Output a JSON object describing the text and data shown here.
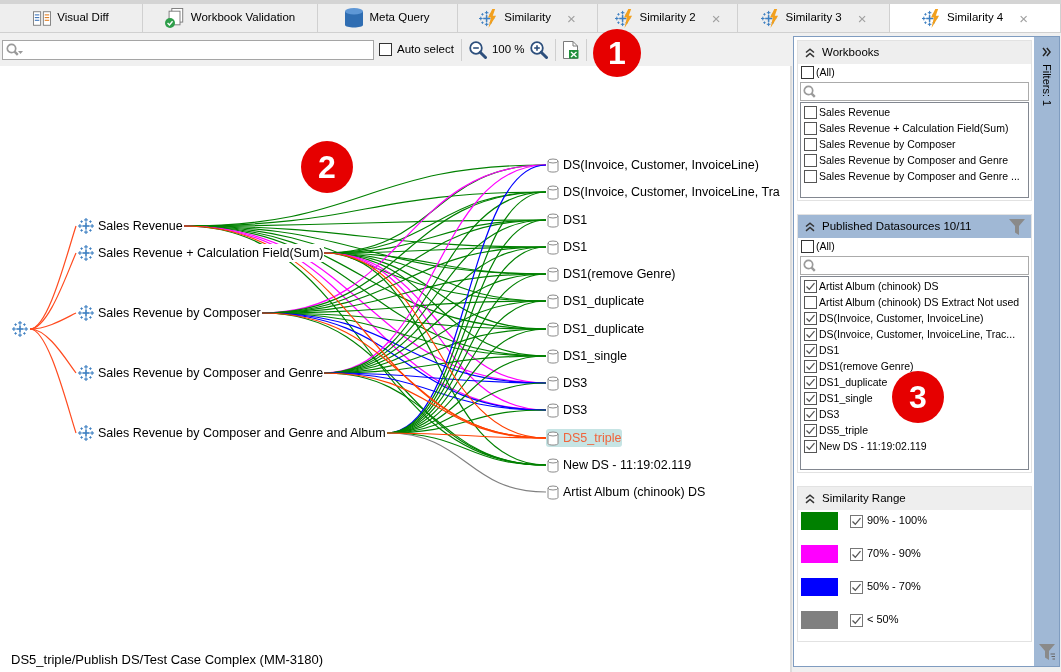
{
  "tabs": [
    {
      "label": "Visual Diff",
      "kind": "diff",
      "selected": false
    },
    {
      "label": "Workbook Validation",
      "kind": "validation",
      "selected": false
    },
    {
      "label": "Meta Query",
      "kind": "query",
      "selected": false
    },
    {
      "label": "Similarity",
      "kind": "similarity",
      "selected": false,
      "close": "×"
    },
    {
      "label": "Similarity 2",
      "kind": "similarity",
      "selected": false,
      "close": "×"
    },
    {
      "label": "Similarity 3",
      "kind": "similarity",
      "selected": false,
      "close": "×"
    },
    {
      "label": "Similarity 4",
      "kind": "similarity",
      "selected": true,
      "close": "×"
    }
  ],
  "toolbar": {
    "auto_select": {
      "label": "Auto select",
      "checked": false
    },
    "zoom": "100 %"
  },
  "graph": {
    "workbooks": [
      {
        "label": "Sales Revenue",
        "edges": [
          {
            "kind": "high"
          },
          {
            "kind": "high"
          },
          {
            "kind": "high"
          },
          {
            "kind": "high"
          },
          {
            "kind": "high"
          },
          {
            "kind": "high"
          },
          {
            "kind": "high"
          },
          {
            "kind": "high"
          },
          {
            "kind": "medium"
          },
          {
            "kind": "medium"
          },
          {
            "kind": "highlighted"
          },
          {
            "kind": "high"
          }
        ]
      },
      {
        "label": "Sales Revenue + Calculation Field(Sum)",
        "edges": [
          {
            "kind": "high"
          },
          {
            "kind": "high"
          },
          {
            "kind": "high"
          },
          {
            "kind": "high"
          },
          {
            "kind": "high"
          },
          {
            "kind": "high"
          },
          {
            "kind": "high"
          },
          {
            "kind": "high"
          },
          {
            "kind": "medium"
          },
          {
            "kind": "medium"
          },
          {
            "kind": "highlighted"
          },
          {
            "kind": "high"
          }
        ]
      },
      {
        "label": "Sales Revenue by Composer",
        "edges": [
          {
            "kind": "medium"
          },
          {
            "kind": "high"
          },
          {
            "kind": "high"
          },
          {
            "kind": "high"
          },
          {
            "kind": "high"
          },
          {
            "kind": "high"
          },
          {
            "kind": "high"
          },
          {
            "kind": "high"
          },
          {
            "kind": "low"
          },
          {
            "kind": "low"
          },
          {
            "kind": "highlighted"
          },
          {
            "kind": "high"
          }
        ]
      },
      {
        "label": "Sales Revenue by Composer and Genre",
        "edges": [
          {
            "kind": "medium"
          },
          {
            "kind": "high"
          },
          {
            "kind": "high"
          },
          {
            "kind": "high"
          },
          {
            "kind": "high"
          },
          {
            "kind": "high"
          },
          {
            "kind": "high"
          },
          {
            "kind": "high"
          },
          {
            "kind": "low"
          },
          {
            "kind": "low"
          },
          {
            "kind": "highlighted"
          },
          {
            "kind": "high"
          }
        ]
      },
      {
        "label": "Sales Revenue by Composer and Genre and Album",
        "edges": [
          {
            "kind": "low"
          },
          {
            "kind": "high"
          },
          {
            "kind": "high"
          },
          {
            "kind": "high"
          },
          {
            "kind": "high"
          },
          {
            "kind": "high"
          },
          {
            "kind": "high"
          },
          {
            "kind": "high"
          },
          {
            "kind": "high"
          },
          {
            "kind": "high"
          },
          {
            "kind": "highlighted"
          },
          {
            "kind": "high"
          },
          {
            "kind": "minimal"
          }
        ]
      }
    ],
    "datasources": [
      {
        "label": "DS(Invoice, Customer, InvoiceLine)",
        "selected": false
      },
      {
        "label": "DS(Invoice, Customer, InvoiceLine, Tra",
        "selected": false
      },
      {
        "label": "DS1",
        "selected": false
      },
      {
        "label": "DS1",
        "selected": false
      },
      {
        "label": "DS1(remove Genre)",
        "selected": false
      },
      {
        "label": "DS1_duplicate",
        "selected": false
      },
      {
        "label": "DS1_duplicate",
        "selected": false
      },
      {
        "label": "DS1_single",
        "selected": false
      },
      {
        "label": "DS3",
        "selected": false
      },
      {
        "label": "DS3",
        "selected": false
      },
      {
        "label": "DS5_triple",
        "selected": true
      },
      {
        "label": "New DS - 11:19:02.119",
        "selected": false
      },
      {
        "label": "Artist Album (chinook) DS",
        "selected": false
      }
    ]
  },
  "status_bar": "DS5_triple/Publish DS/Test Case Complex (MM-3180)",
  "filters": {
    "sections": [
      {
        "title": "Workbooks",
        "kind": "checklist",
        "filtered": false,
        "all": {
          "label": "(All)",
          "checked": false
        },
        "items": [
          {
            "label": "Sales Revenue",
            "checked": false
          },
          {
            "label": "Sales Revenue + Calculation Field(Sum)",
            "checked": false
          },
          {
            "label": "Sales Revenue by Composer",
            "checked": false
          },
          {
            "label": "Sales Revenue by Composer and Genre",
            "checked": false
          },
          {
            "label": "Sales Revenue by Composer and Genre ...",
            "checked": false
          }
        ]
      },
      {
        "title": "Published Datasources 10/11",
        "kind": "checklist",
        "filtered": true,
        "all": {
          "label": "(All)",
          "checked": false
        },
        "items": [
          {
            "label": "Artist Album (chinook) DS",
            "checked": true
          },
          {
            "label": "Artist Album (chinook) DS Extract Not used",
            "checked": false
          },
          {
            "label": "DS(Invoice, Customer, InvoiceLine)",
            "checked": true
          },
          {
            "label": "DS(Invoice, Customer, InvoiceLine, Trac...",
            "checked": true
          },
          {
            "label": "DS1",
            "checked": true
          },
          {
            "label": "DS1(remove Genre)",
            "checked": true
          },
          {
            "label": "DS1_duplicate",
            "checked": true
          },
          {
            "label": "DS1_single",
            "checked": true
          },
          {
            "label": "DS3",
            "checked": true
          },
          {
            "label": "DS5_triple",
            "checked": true
          },
          {
            "label": "New DS - 11:19:02.119",
            "checked": true
          }
        ]
      },
      {
        "title": "Similarity Range",
        "kind": "legend",
        "filtered": false,
        "items": [
          {
            "label": "90% - 100%",
            "color": "#008000",
            "checked": true
          },
          {
            "label": "70% - 90%",
            "color": "#ff00ff",
            "checked": true
          },
          {
            "label": "50% - 70%",
            "color": "#0000ff",
            "checked": true
          },
          {
            "label": "< 50%",
            "color": "#808080",
            "checked": true
          }
        ]
      }
    ],
    "rail": "Filters: 1"
  },
  "callouts": [
    "1",
    "2",
    "3"
  ]
}
